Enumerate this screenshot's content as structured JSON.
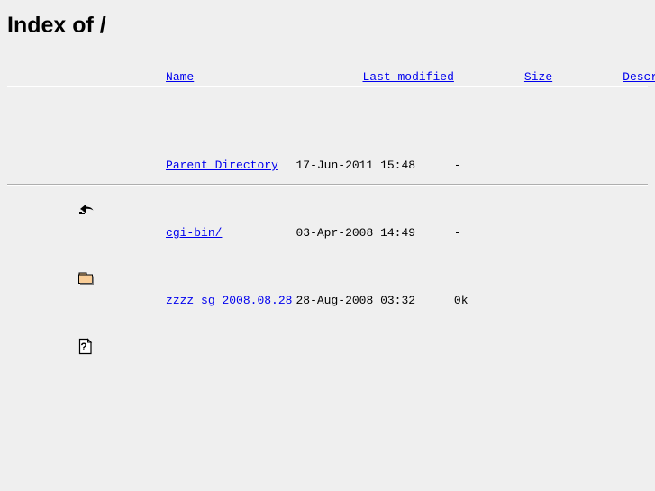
{
  "page": {
    "title": "Index of /",
    "background_color": "#efefef",
    "link_color": "#0000ee",
    "text_color": "#000000",
    "rule_color": "#aeaeae"
  },
  "table": {
    "headers": {
      "icon": "",
      "name": "Name",
      "last_modified": "Last modified",
      "size": "Size",
      "description": "Description"
    },
    "rows": [
      {
        "icon": "back-icon",
        "name": "Parent Directory",
        "last_modified": "17-Jun-2011 15:48",
        "size": "-",
        "description": ""
      },
      {
        "icon": "folder-icon",
        "name": "cgi-bin/",
        "last_modified": "03-Apr-2008 14:49",
        "size": "-",
        "description": ""
      },
      {
        "icon": "unknown-file-icon",
        "name": "zzzz_sg_2008.08.28",
        "last_modified": "28-Aug-2008 03:32",
        "size": "0k",
        "description": ""
      }
    ]
  }
}
